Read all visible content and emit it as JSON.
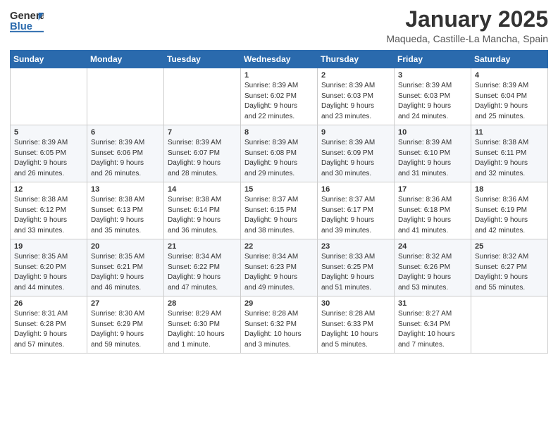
{
  "header": {
    "logo_general": "General",
    "logo_blue": "Blue",
    "title": "January 2025",
    "location": "Maqueda, Castille-La Mancha, Spain"
  },
  "weekdays": [
    "Sunday",
    "Monday",
    "Tuesday",
    "Wednesday",
    "Thursday",
    "Friday",
    "Saturday"
  ],
  "weeks": [
    [
      {
        "day": "",
        "info": ""
      },
      {
        "day": "",
        "info": ""
      },
      {
        "day": "",
        "info": ""
      },
      {
        "day": "1",
        "info": "Sunrise: 8:39 AM\nSunset: 6:02 PM\nDaylight: 9 hours\nand 22 minutes."
      },
      {
        "day": "2",
        "info": "Sunrise: 8:39 AM\nSunset: 6:03 PM\nDaylight: 9 hours\nand 23 minutes."
      },
      {
        "day": "3",
        "info": "Sunrise: 8:39 AM\nSunset: 6:03 PM\nDaylight: 9 hours\nand 24 minutes."
      },
      {
        "day": "4",
        "info": "Sunrise: 8:39 AM\nSunset: 6:04 PM\nDaylight: 9 hours\nand 25 minutes."
      }
    ],
    [
      {
        "day": "5",
        "info": "Sunrise: 8:39 AM\nSunset: 6:05 PM\nDaylight: 9 hours\nand 26 minutes."
      },
      {
        "day": "6",
        "info": "Sunrise: 8:39 AM\nSunset: 6:06 PM\nDaylight: 9 hours\nand 26 minutes."
      },
      {
        "day": "7",
        "info": "Sunrise: 8:39 AM\nSunset: 6:07 PM\nDaylight: 9 hours\nand 28 minutes."
      },
      {
        "day": "8",
        "info": "Sunrise: 8:39 AM\nSunset: 6:08 PM\nDaylight: 9 hours\nand 29 minutes."
      },
      {
        "day": "9",
        "info": "Sunrise: 8:39 AM\nSunset: 6:09 PM\nDaylight: 9 hours\nand 30 minutes."
      },
      {
        "day": "10",
        "info": "Sunrise: 8:39 AM\nSunset: 6:10 PM\nDaylight: 9 hours\nand 31 minutes."
      },
      {
        "day": "11",
        "info": "Sunrise: 8:38 AM\nSunset: 6:11 PM\nDaylight: 9 hours\nand 32 minutes."
      }
    ],
    [
      {
        "day": "12",
        "info": "Sunrise: 8:38 AM\nSunset: 6:12 PM\nDaylight: 9 hours\nand 33 minutes."
      },
      {
        "day": "13",
        "info": "Sunrise: 8:38 AM\nSunset: 6:13 PM\nDaylight: 9 hours\nand 35 minutes."
      },
      {
        "day": "14",
        "info": "Sunrise: 8:38 AM\nSunset: 6:14 PM\nDaylight: 9 hours\nand 36 minutes."
      },
      {
        "day": "15",
        "info": "Sunrise: 8:37 AM\nSunset: 6:15 PM\nDaylight: 9 hours\nand 38 minutes."
      },
      {
        "day": "16",
        "info": "Sunrise: 8:37 AM\nSunset: 6:17 PM\nDaylight: 9 hours\nand 39 minutes."
      },
      {
        "day": "17",
        "info": "Sunrise: 8:36 AM\nSunset: 6:18 PM\nDaylight: 9 hours\nand 41 minutes."
      },
      {
        "day": "18",
        "info": "Sunrise: 8:36 AM\nSunset: 6:19 PM\nDaylight: 9 hours\nand 42 minutes."
      }
    ],
    [
      {
        "day": "19",
        "info": "Sunrise: 8:35 AM\nSunset: 6:20 PM\nDaylight: 9 hours\nand 44 minutes."
      },
      {
        "day": "20",
        "info": "Sunrise: 8:35 AM\nSunset: 6:21 PM\nDaylight: 9 hours\nand 46 minutes."
      },
      {
        "day": "21",
        "info": "Sunrise: 8:34 AM\nSunset: 6:22 PM\nDaylight: 9 hours\nand 47 minutes."
      },
      {
        "day": "22",
        "info": "Sunrise: 8:34 AM\nSunset: 6:23 PM\nDaylight: 9 hours\nand 49 minutes."
      },
      {
        "day": "23",
        "info": "Sunrise: 8:33 AM\nSunset: 6:25 PM\nDaylight: 9 hours\nand 51 minutes."
      },
      {
        "day": "24",
        "info": "Sunrise: 8:32 AM\nSunset: 6:26 PM\nDaylight: 9 hours\nand 53 minutes."
      },
      {
        "day": "25",
        "info": "Sunrise: 8:32 AM\nSunset: 6:27 PM\nDaylight: 9 hours\nand 55 minutes."
      }
    ],
    [
      {
        "day": "26",
        "info": "Sunrise: 8:31 AM\nSunset: 6:28 PM\nDaylight: 9 hours\nand 57 minutes."
      },
      {
        "day": "27",
        "info": "Sunrise: 8:30 AM\nSunset: 6:29 PM\nDaylight: 9 hours\nand 59 minutes."
      },
      {
        "day": "28",
        "info": "Sunrise: 8:29 AM\nSunset: 6:30 PM\nDaylight: 10 hours\nand 1 minute."
      },
      {
        "day": "29",
        "info": "Sunrise: 8:28 AM\nSunset: 6:32 PM\nDaylight: 10 hours\nand 3 minutes."
      },
      {
        "day": "30",
        "info": "Sunrise: 8:28 AM\nSunset: 6:33 PM\nDaylight: 10 hours\nand 5 minutes."
      },
      {
        "day": "31",
        "info": "Sunrise: 8:27 AM\nSunset: 6:34 PM\nDaylight: 10 hours\nand 7 minutes."
      },
      {
        "day": "",
        "info": ""
      }
    ]
  ]
}
